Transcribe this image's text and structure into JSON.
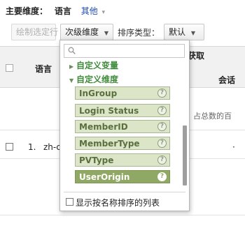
{
  "header": {
    "primary_dimension_label": "主要维度：",
    "current_dimension": "语言",
    "other_link": "其他"
  },
  "toolbar": {
    "plot_rows_label": "绘制选定行",
    "secondary_dimension_label": "次级维度",
    "sort_type_label": "排序类型：",
    "sort_value": "默认"
  },
  "table": {
    "language_header": "语言",
    "acquisition_header": "获取",
    "sessions_header": "会话",
    "totals_text": "占总数的百",
    "rows": [
      {
        "index": "1.",
        "language": "zh-c"
      }
    ],
    "row1_value_partial": "·"
  },
  "dropdown": {
    "search_placeholder": "",
    "groups": {
      "custom_variables": "自定义变量",
      "custom_dimensions": "自定义维度"
    },
    "items": [
      {
        "label": "InGroup",
        "selected": false
      },
      {
        "label": "Login Status",
        "selected": false
      },
      {
        "label": "MemberID",
        "selected": false
      },
      {
        "label": "MemberType",
        "selected": false
      },
      {
        "label": "PVType",
        "selected": false
      },
      {
        "label": "UserOrigin",
        "selected": true
      }
    ],
    "help_glyph": "?",
    "alphabetical_label": "显示按名称排序的列表"
  },
  "colors": {
    "item_bg": "#dde5c9",
    "item_selected_bg": "#8fa863",
    "group_text": "#3f8b3b",
    "link_blue": "#1a4bb4"
  },
  "icons": {
    "search": "search-icon",
    "help": "help-icon",
    "expand": "triangle-down-icon",
    "collapse": "triangle-right-icon",
    "caret": "chevron-down-icon"
  }
}
